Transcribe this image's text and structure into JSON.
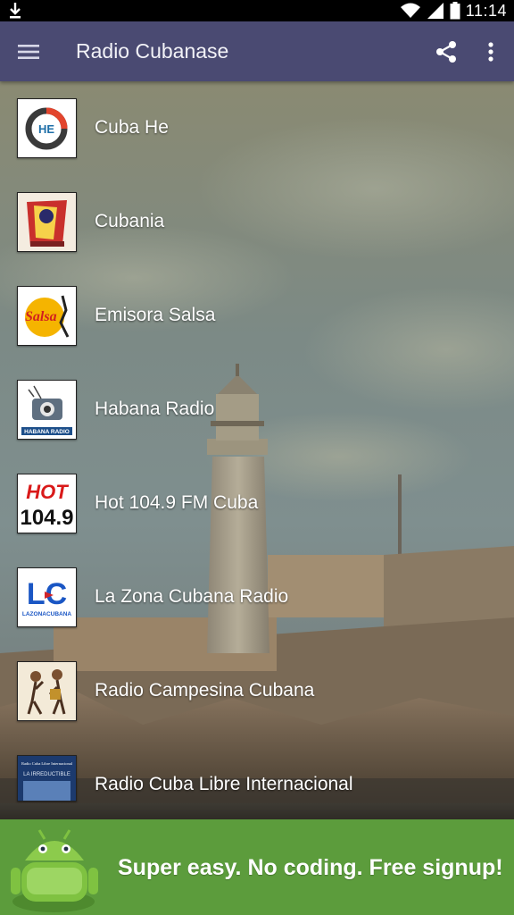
{
  "status_bar": {
    "time": "11:14",
    "icons": [
      "download-icon",
      "wifi-icon",
      "signal-icon",
      "battery-icon"
    ]
  },
  "app_bar": {
    "title": "Radio Cubanase",
    "icons": [
      "menu-icon",
      "share-icon",
      "more-vert-icon"
    ],
    "color": "#4a4a72"
  },
  "stations": [
    {
      "name": "Cuba He"
    },
    {
      "name": "Cubania"
    },
    {
      "name": "Emisora Salsa"
    },
    {
      "name": "Habana Radio"
    },
    {
      "name": "Hot 104.9 FM Cuba"
    },
    {
      "name": "La Zona Cubana Radio"
    },
    {
      "name": "Radio Campesina Cubana"
    },
    {
      "name": "Radio Cuba Libre Internacional"
    }
  ],
  "thumb_text": {
    "emisora_salsa": "Salsa",
    "habana_radio": "HABANA RADIO",
    "hot_top": "HOT",
    "hot_bottom": "104.9",
    "la_zona": "LC",
    "la_zona_sub": "LAZONACUBANA",
    "cuba_libre_top": "Radio Cuba Libre Internacional",
    "cuba_libre_sub": "LA IRREDUCTIBLE",
    "cuba_he": "HE"
  },
  "ad_banner": {
    "text": "Super easy. No coding. Free signup!",
    "color": "#5c9c3c"
  }
}
